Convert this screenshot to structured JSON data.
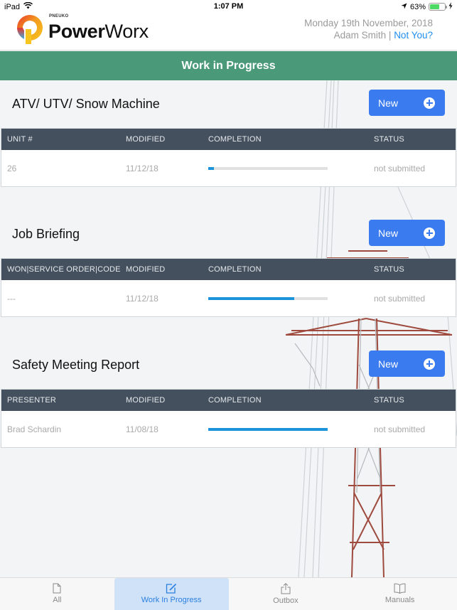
{
  "status_bar": {
    "device": "iPad",
    "time": "1:07 PM",
    "battery_percent": "63%",
    "battery_level": 0.63
  },
  "header": {
    "brand_small": "PNEUKO",
    "brand_bold": "Power",
    "brand_light": "Worx",
    "date": "Monday 19th November, 2018",
    "user_name": "Adam Smith",
    "separator": "|",
    "not_you_link": "Not You?"
  },
  "title_bar": {
    "title": "Work in Progress"
  },
  "colors": {
    "title_bar": "#4a9a7a",
    "new_button": "#3a7bf0",
    "table_header": "#44505e",
    "progress_fill": "#1b94dc",
    "link": "#1f8ef1"
  },
  "sections": [
    {
      "title": "ATV/ UTV/ Snow Machine",
      "new_label": "New",
      "columns": [
        "UNIT #",
        "MODIFIED",
        "COMPLETION",
        "STATUS"
      ],
      "rows": [
        {
          "id": "26",
          "modified": "11/12/18",
          "completion": 0.05,
          "status": "not submitted"
        }
      ]
    },
    {
      "title": "Job Briefing",
      "new_label": "New",
      "columns": [
        "WON|SERVICE ORDER|CODE",
        "MODIFIED",
        "COMPLETION",
        "STATUS"
      ],
      "rows": [
        {
          "id": "---",
          "modified": "11/12/18",
          "completion": 0.72,
          "status": "not submitted"
        }
      ]
    },
    {
      "title": "Safety Meeting Report",
      "new_label": "New",
      "columns": [
        "PRESENTER",
        "MODIFIED",
        "COMPLETION",
        "STATUS"
      ],
      "rows": [
        {
          "id": "Brad Schardin",
          "modified": "11/08/18",
          "completion": 1.0,
          "status": "not submitted"
        }
      ]
    }
  ],
  "tab_bar": {
    "tabs": [
      {
        "label": "All",
        "icon": "document-icon",
        "active": false
      },
      {
        "label": "Work In Progress",
        "icon": "compose-icon",
        "active": true
      },
      {
        "label": "Outbox",
        "icon": "share-icon",
        "active": false
      },
      {
        "label": "Manuals",
        "icon": "book-icon",
        "active": false
      }
    ]
  }
}
